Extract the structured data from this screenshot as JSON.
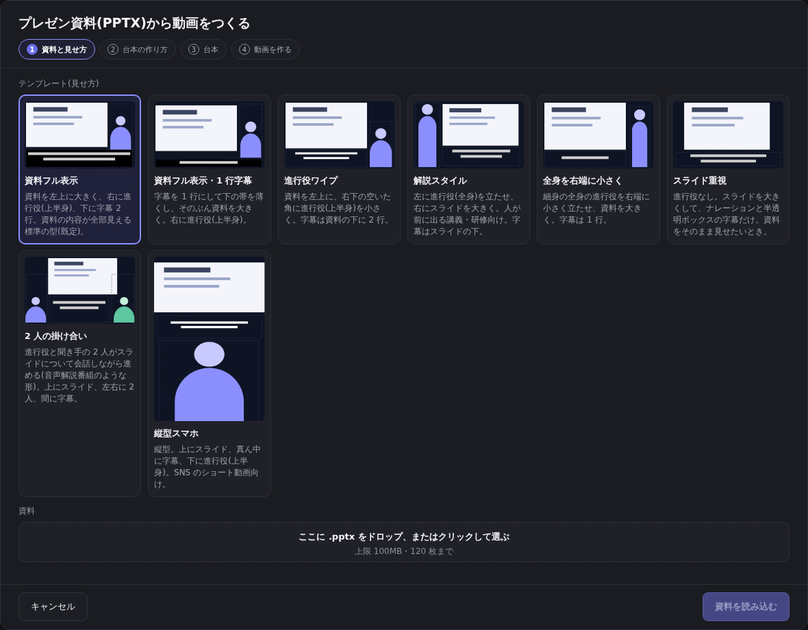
{
  "dialog": {
    "title": "プレゼン資料(PPTX)から動画をつくる",
    "steps": [
      {
        "number": "1",
        "label": "資料と見せ方",
        "selected": true
      },
      {
        "number": "2",
        "label": "台本の作り方",
        "selected": false
      },
      {
        "number": "3",
        "label": "台本",
        "selected": false
      },
      {
        "number": "4",
        "label": "動画を作る",
        "selected": false
      }
    ]
  },
  "templates_label": "テンプレート(見せ方)",
  "templates": [
    {
      "kind": "full",
      "title": "資料フル表示",
      "description": "資料を左上に大きく、右に進行役(上半身)、下に字幕 2 行。資料の内容が全部見える標準の型(既定)。",
      "selected": true
    },
    {
      "kind": "full_one_line",
      "title": "資料フル表示・1 行字幕",
      "description": "字幕を 1 行にして下の帯を薄くし、そのぶん資料を大きく。右に進行役(上半身)。",
      "selected": false
    },
    {
      "kind": "wipe",
      "title": "進行役ワイプ",
      "description": "資料を左上に、右下の空いた角に進行役(上半身)を小さく。字幕は資料の下に 2 行。",
      "selected": false
    },
    {
      "kind": "explainer",
      "title": "解説スタイル",
      "description": "左に進行役(全身)を立たせ、右にスライドを大きく。人が前に出る講義・研修向け。字幕はスライドの下。",
      "selected": false
    },
    {
      "kind": "full_body_right",
      "title": "全身を右端に小さく",
      "description": "細身の全身の進行役を右端に小さく立たせ、資料を大きく。字幕は 1 行。",
      "selected": false
    },
    {
      "kind": "slide_focus",
      "title": "スライド重視",
      "description": "進行役なし。スライドを大きくして、ナレーションと半透明ボックスの字幕だけ。資料をそのまま見せたいとき。",
      "selected": false
    },
    {
      "kind": "duo",
      "title": "2 人の掛け合い",
      "description": "進行役と聞き手の 2 人がスライドについて会話しながら進める(音声解説番組のような形)。上にスライド、左右に 2 人、間に字幕。",
      "selected": false
    },
    {
      "kind": "vertical",
      "title": "縦型スマホ",
      "description": "縦型。上にスライド、真ん中に字幕、下に進行役(上半身)。SNS のショート動画向け。",
      "selected": false
    }
  ],
  "material_label": "資料",
  "dropzone": {
    "title": "ここに .pptx をドロップ、またはクリックして選ぶ",
    "hint": "上限 100MB・120 枚まで"
  },
  "footer": {
    "cancel": "キャンセル",
    "submit": {
      "label": "資料を読み込む",
      "disabled": true
    }
  }
}
